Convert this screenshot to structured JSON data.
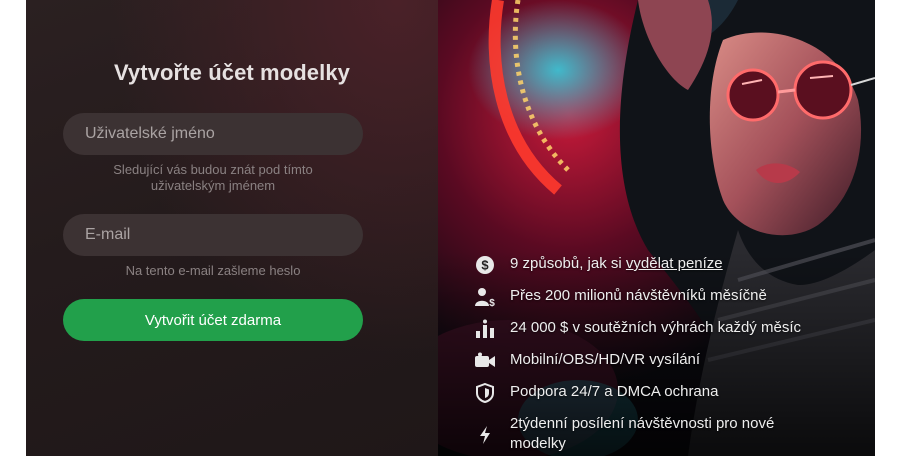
{
  "form": {
    "title": "Vytvořte účet modelky",
    "username": {
      "placeholder": "Uživatelské jméno",
      "value": "",
      "hint": "Sledující vás budou znát pod tímto uživatelským jménem"
    },
    "email": {
      "placeholder": "E-mail",
      "value": "",
      "hint": "Na tento e-mail zašleme heslo"
    },
    "submit_label": "Vytvořit účet zdarma"
  },
  "features": [
    {
      "icon": "dollar-circle-icon",
      "text": "9 způsobů, jak si ",
      "link": "vydělat peníze"
    },
    {
      "icon": "user-dollar-icon",
      "text": "Přes 200 milionů návštěvníků měsíčně"
    },
    {
      "icon": "trophy-bars-icon",
      "text": "24 000 $ v soutěžních výhrách každý měsíc"
    },
    {
      "icon": "camera-icon",
      "text": "Mobilní/OBS/HD/VR vysílání"
    },
    {
      "icon": "shield-icon",
      "text": "Podpora 24/7 a DMCA ochrana"
    },
    {
      "icon": "lightning-icon",
      "text": "2týdenní posílení návštěvnosti pro nové modelky"
    }
  ],
  "colors": {
    "cta": "#22a04b",
    "panel": "#241b1c",
    "field": "#3c3233"
  }
}
